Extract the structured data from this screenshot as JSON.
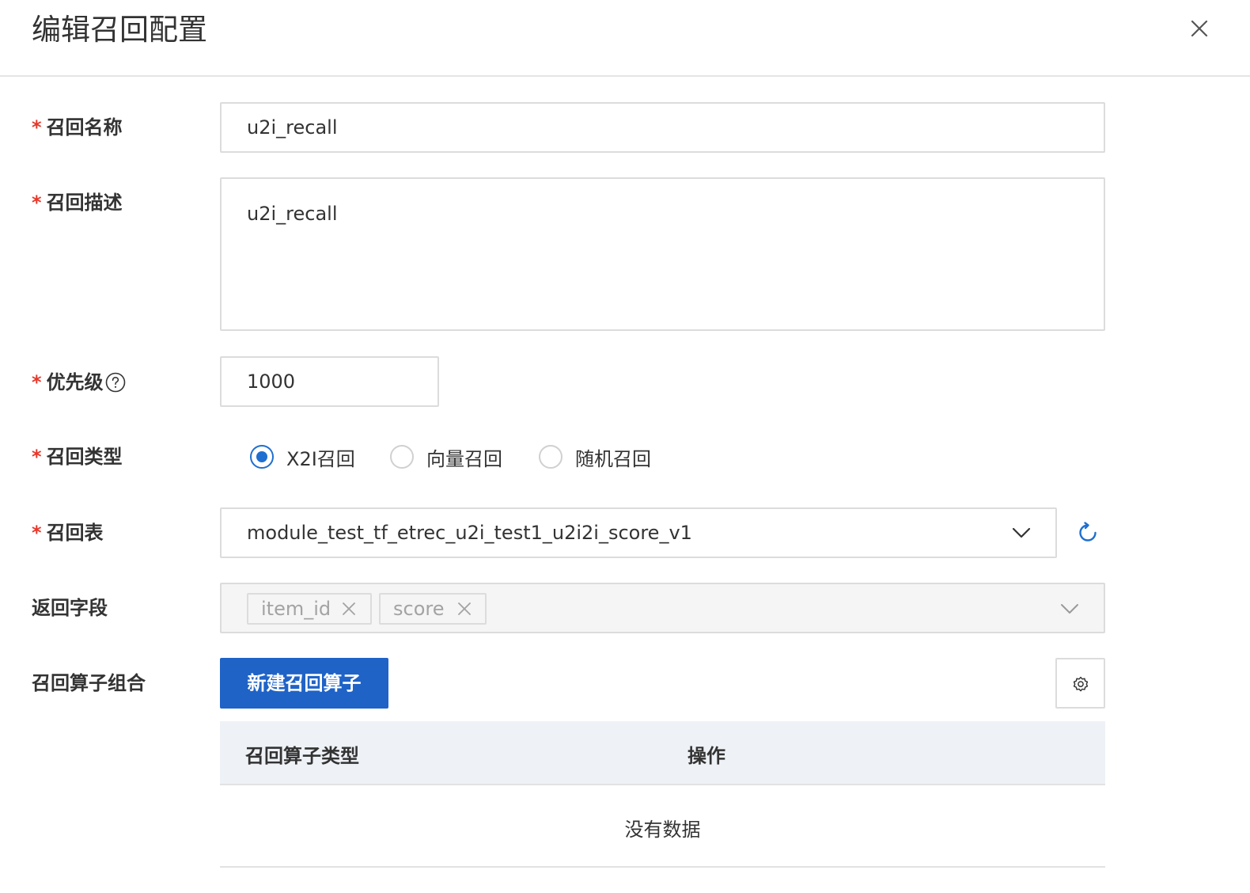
{
  "dialog": {
    "title": "编辑召回配置"
  },
  "form": {
    "required_mark": "*",
    "recall_name": {
      "label": "召回名称",
      "value": "u2i_recall"
    },
    "recall_desc": {
      "label": "召回描述",
      "value": "u2i_recall"
    },
    "priority": {
      "label": "优先级",
      "value": "1000"
    },
    "recall_type": {
      "label": "召回类型",
      "options": [
        "X2I召回",
        "向量召回",
        "随机召回"
      ],
      "selected": "X2I召回"
    },
    "recall_table": {
      "label": "召回表",
      "value": "module_test_tf_etrec_u2i_test1_u2i2i_score_v1"
    },
    "return_fields": {
      "label": "返回字段",
      "tags": [
        "item_id",
        "score"
      ]
    },
    "operator_combo": {
      "label": "召回算子组合",
      "new_button": "新建召回算子"
    }
  },
  "table": {
    "columns": [
      "召回算子类型",
      "操作"
    ],
    "empty_text": "没有数据"
  },
  "colors": {
    "primary": "#1f63c7",
    "required": "#e5382a",
    "table_header_bg": "#eef2f6"
  },
  "icons": [
    "close-icon",
    "help-icon",
    "chevron-down-icon",
    "refresh-icon",
    "tag-close-icon",
    "settings-icon"
  ]
}
